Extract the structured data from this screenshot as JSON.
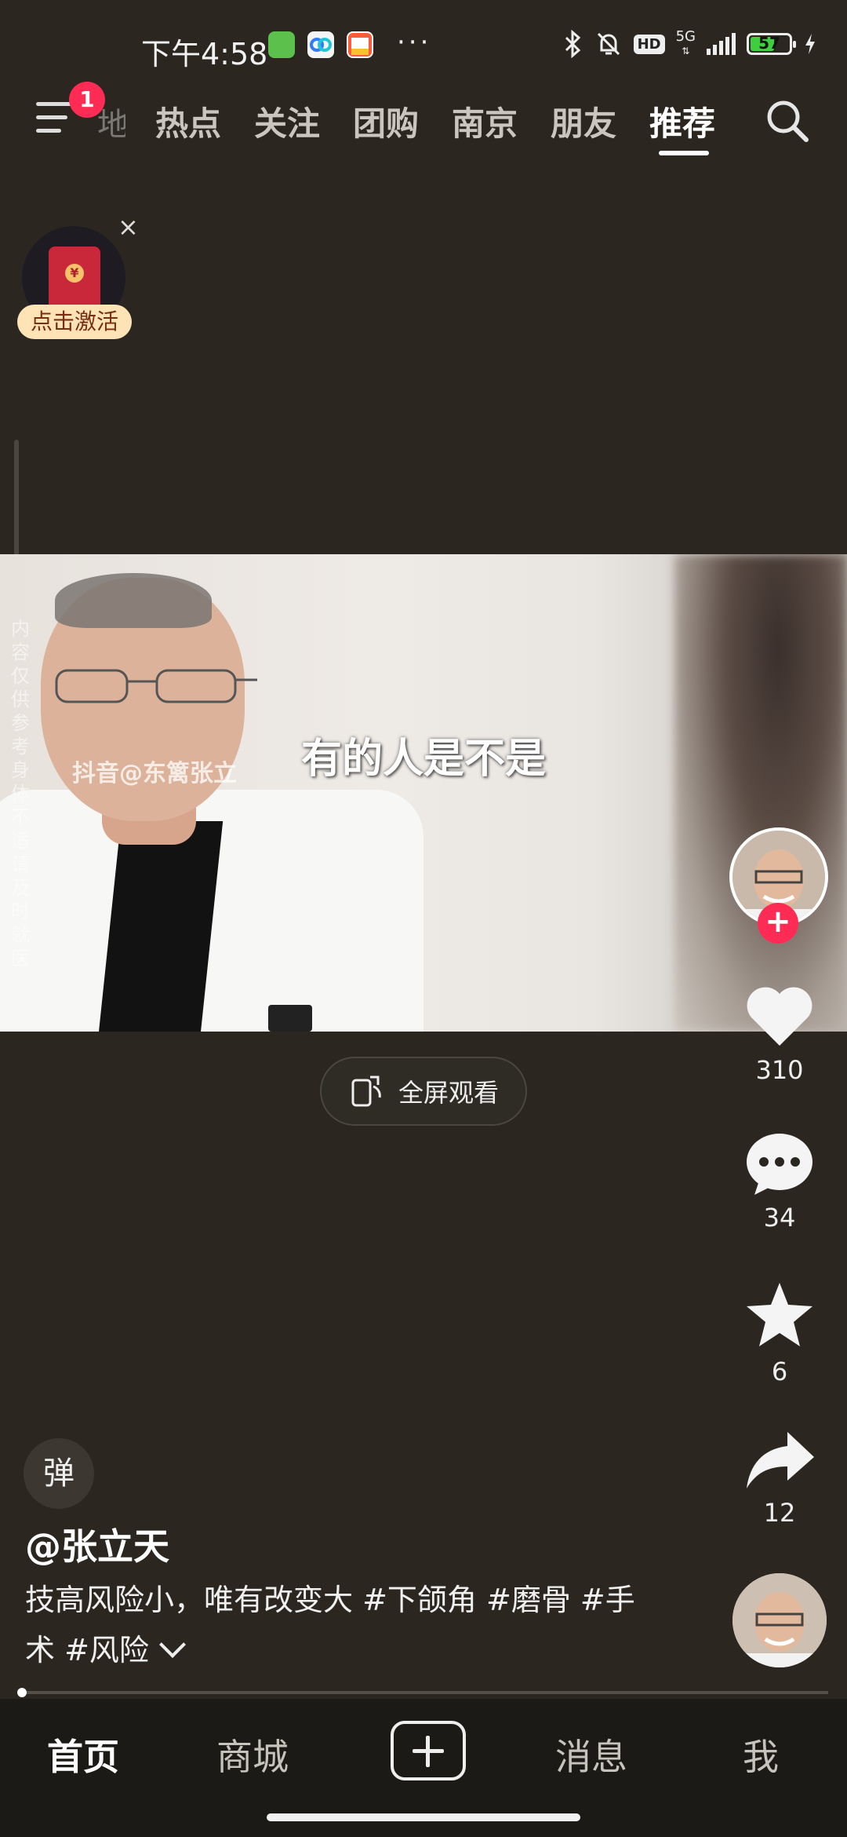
{
  "status": {
    "time": "下午4:58",
    "more": "···",
    "hd": "HD",
    "network": "5G",
    "battery": "57",
    "battery_level": 0.57
  },
  "nav": {
    "notification_count": "1",
    "partial_tab": "地",
    "tabs": [
      "热点",
      "关注",
      "团购",
      "南京",
      "朋友",
      "推荐"
    ],
    "active_tab": "推荐"
  },
  "promo": {
    "label": "点击激活",
    "close": "×",
    "coin": "¥"
  },
  "video": {
    "subtitle": "有的人是不是",
    "watermark": "抖音@东篱张立",
    "side_notice": "内容仅供参考 身体不适请及时就医"
  },
  "actions": {
    "likes": "310",
    "comments": "34",
    "favorites": "6",
    "shares": "12"
  },
  "fullscreen": {
    "label": "全屏观看"
  },
  "post": {
    "danmaku": "弹",
    "author": "@张立天",
    "caption": "技高风险小，唯有改变大 #下颌角 #磨骨 #手术 #风险"
  },
  "tabbar": {
    "home": "首页",
    "mall": "商城",
    "messages": "消息",
    "me": "我"
  },
  "colors": {
    "accent": "#fe2c55",
    "background": "#2b2720"
  }
}
